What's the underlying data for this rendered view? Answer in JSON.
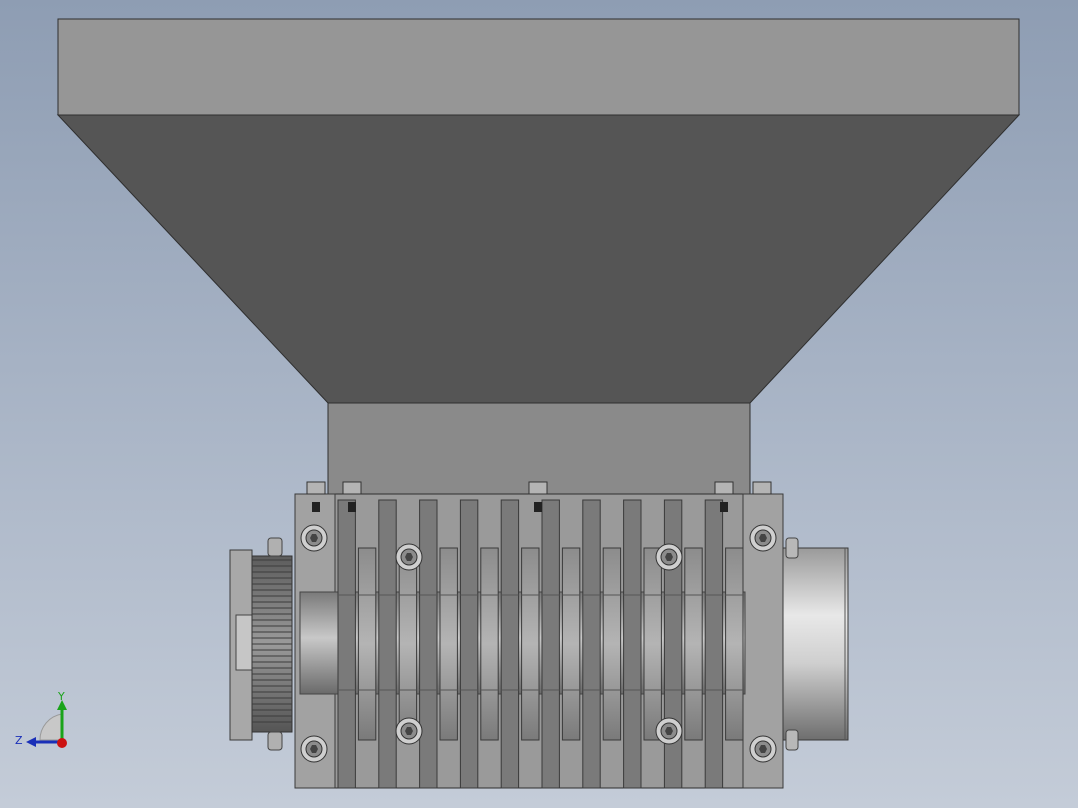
{
  "view": {
    "background_top": "#8e9db3",
    "background_bottom": "#c4ccd8"
  },
  "model": {
    "hopper_rim_color": "#969696",
    "hopper_funnel_color": "#555555",
    "throat_color": "#8a8a8a",
    "housing_color": "#9a9a9a",
    "blade_dark": "#6f6f6f",
    "blade_light": "#b0b0b0",
    "shaft_color": "#a0a0a0",
    "motor_color": "#cfcfcf",
    "gear_color": "#7d7d7d"
  },
  "triad": {
    "y_label": "Y",
    "z_label": "Z",
    "y_color": "#1aa31a",
    "z_color": "#1a2fb8",
    "x_color": "#cc1111"
  }
}
